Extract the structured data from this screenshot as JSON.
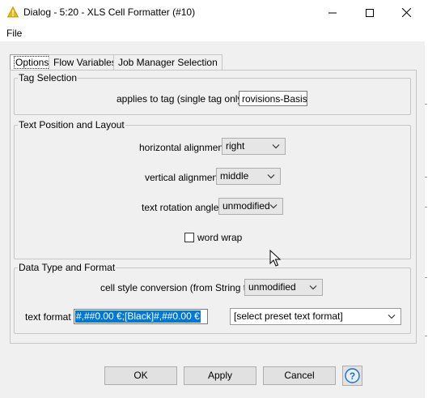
{
  "window": {
    "title": "Dialog - 5:20 - XLS Cell Formatter (#10)",
    "icon": "knime-warning-triangle-icon",
    "accent_icon_color": "#f2b800"
  },
  "menu": {
    "file": "File"
  },
  "tabs": [
    {
      "label": "Options",
      "active": true
    },
    {
      "label": "Flow Variables",
      "active": false
    },
    {
      "label": "Job Manager Selection",
      "active": false
    }
  ],
  "tag_selection": {
    "legend": "Tag Selection",
    "applies_label": "applies to tag (single tag only)",
    "applies_value": "rovisions-Basis €"
  },
  "text_position": {
    "legend": "Text Position and Layout",
    "horizontal_label": "horizontal alignment",
    "horizontal_value": "right",
    "vertical_label": "vertical alignment",
    "vertical_value": "middle",
    "rotation_label": "text rotation angle",
    "rotation_value": "unmodified",
    "word_wrap_label": "word wrap",
    "word_wrap_checked": false
  },
  "data_type": {
    "legend": "Data Type and Format",
    "conversion_label": "cell style conversion (from String to)",
    "conversion_value": "unmodified",
    "text_format_label": "text format",
    "text_format_value": "#,##0.00 €;[Black]#,##0.00 €",
    "preset_value": "[select preset text format]"
  },
  "buttons": {
    "ok": "OK",
    "apply": "Apply",
    "cancel": "Cancel"
  },
  "colors": {
    "selection": "#0078d7",
    "help_icon": "#1f6fc5"
  }
}
